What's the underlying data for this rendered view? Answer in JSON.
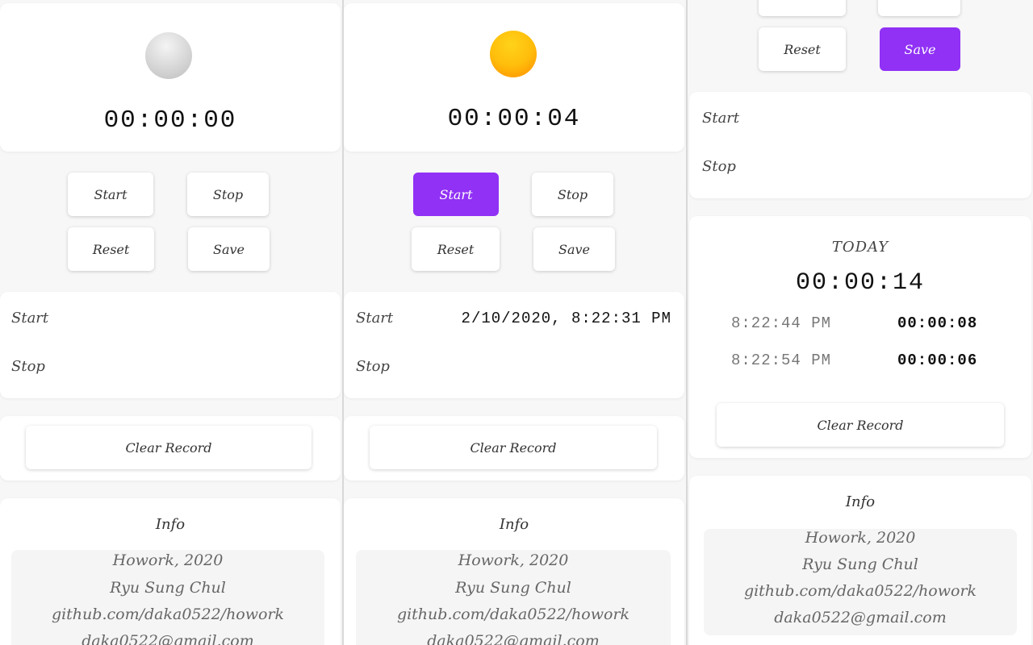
{
  "buttons": {
    "start": "Start",
    "stop": "Stop",
    "reset": "Reset",
    "save": "Save",
    "clear": "Clear Record"
  },
  "labels": {
    "start": "Start",
    "stop": "Stop",
    "info": "Info",
    "today": "TODAY"
  },
  "info": {
    "line1": "Howork, 2020",
    "line2": "Ryu Sung Chul",
    "line3": "github.com/daka0522/howork",
    "line4": "daka0522@gmail.com"
  },
  "panels": [
    {
      "lamp_state": "off",
      "clock": "00:00:00",
      "start_value": "",
      "stop_value": "",
      "active_button": ""
    },
    {
      "lamp_state": "on",
      "clock": "00:00:04",
      "start_value": "2/10/2020, 8:22:31 PM",
      "stop_value": "",
      "active_button": "start"
    },
    {
      "start_value": "",
      "stop_value": "",
      "active_button": "save",
      "today_total": "00:00:14",
      "records": [
        {
          "time": "8:22:44 PM",
          "duration": "00:00:08"
        },
        {
          "time": "8:22:54 PM",
          "duration": "00:00:06"
        }
      ]
    }
  ],
  "colors": {
    "accent": "#9031f5",
    "lamp_on": "#ffbe0b",
    "lamp_off": "#d6d6d6"
  }
}
